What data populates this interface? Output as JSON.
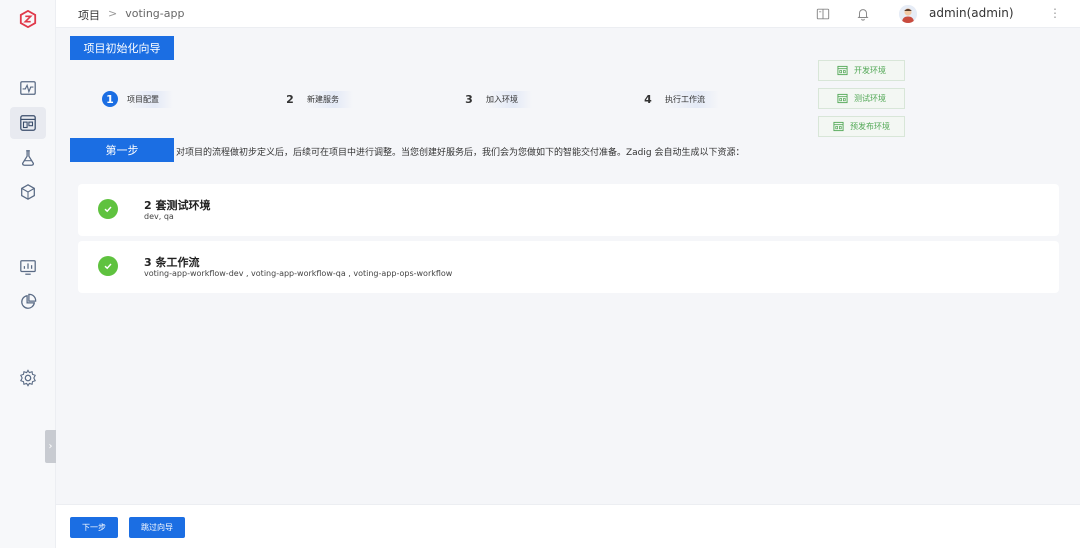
{
  "colors": {
    "primary": "#1b6ee3",
    "success": "#5fc23f",
    "env_text": "#52a856"
  },
  "sidebar": {
    "logo_icon": "zadig-logo-icon",
    "items": [
      {
        "name": "dashboard-icon"
      },
      {
        "name": "projects-icon",
        "active": true
      },
      {
        "name": "test-flask-icon"
      },
      {
        "name": "artifact-package-icon"
      },
      {
        "name": "monitor-chart-icon"
      },
      {
        "name": "pie-chart-icon"
      },
      {
        "name": "gear-icon"
      }
    ],
    "collapse_icon": "chevron-right-icon"
  },
  "header": {
    "breadcrumb": {
      "root": "项目",
      "separator": ">",
      "current": "voting-app"
    },
    "icons": [
      "book-icon",
      "bell-icon",
      "more-vertical-icon"
    ],
    "user": "admin(admin)"
  },
  "wizard": {
    "title": "项目初始化向导",
    "steps": [
      {
        "num": "1",
        "label": "项目配置"
      },
      {
        "num": "2",
        "label": "新建服务"
      },
      {
        "num": "3",
        "label": "加入环境"
      },
      {
        "num": "4",
        "label": "执行工作流"
      }
    ],
    "envs": [
      "开发环境",
      "测试环境",
      "预发布环境"
    ],
    "step_banner": "第一步",
    "description": "对项目的流程做初步定义后，后续可在项目中进行调整。当您创建好服务后，我们会为您做如下的智能交付准备。Zadig 会自动生成以下资源："
  },
  "resources": [
    {
      "title": "2 套测试环境",
      "detail": "dev, qa"
    },
    {
      "title": "3 条工作流",
      "detail": "voting-app-workflow-dev , voting-app-workflow-qa , voting-app-ops-workflow"
    }
  ],
  "footer": {
    "next": "下一步",
    "skip": "跳过向导"
  }
}
